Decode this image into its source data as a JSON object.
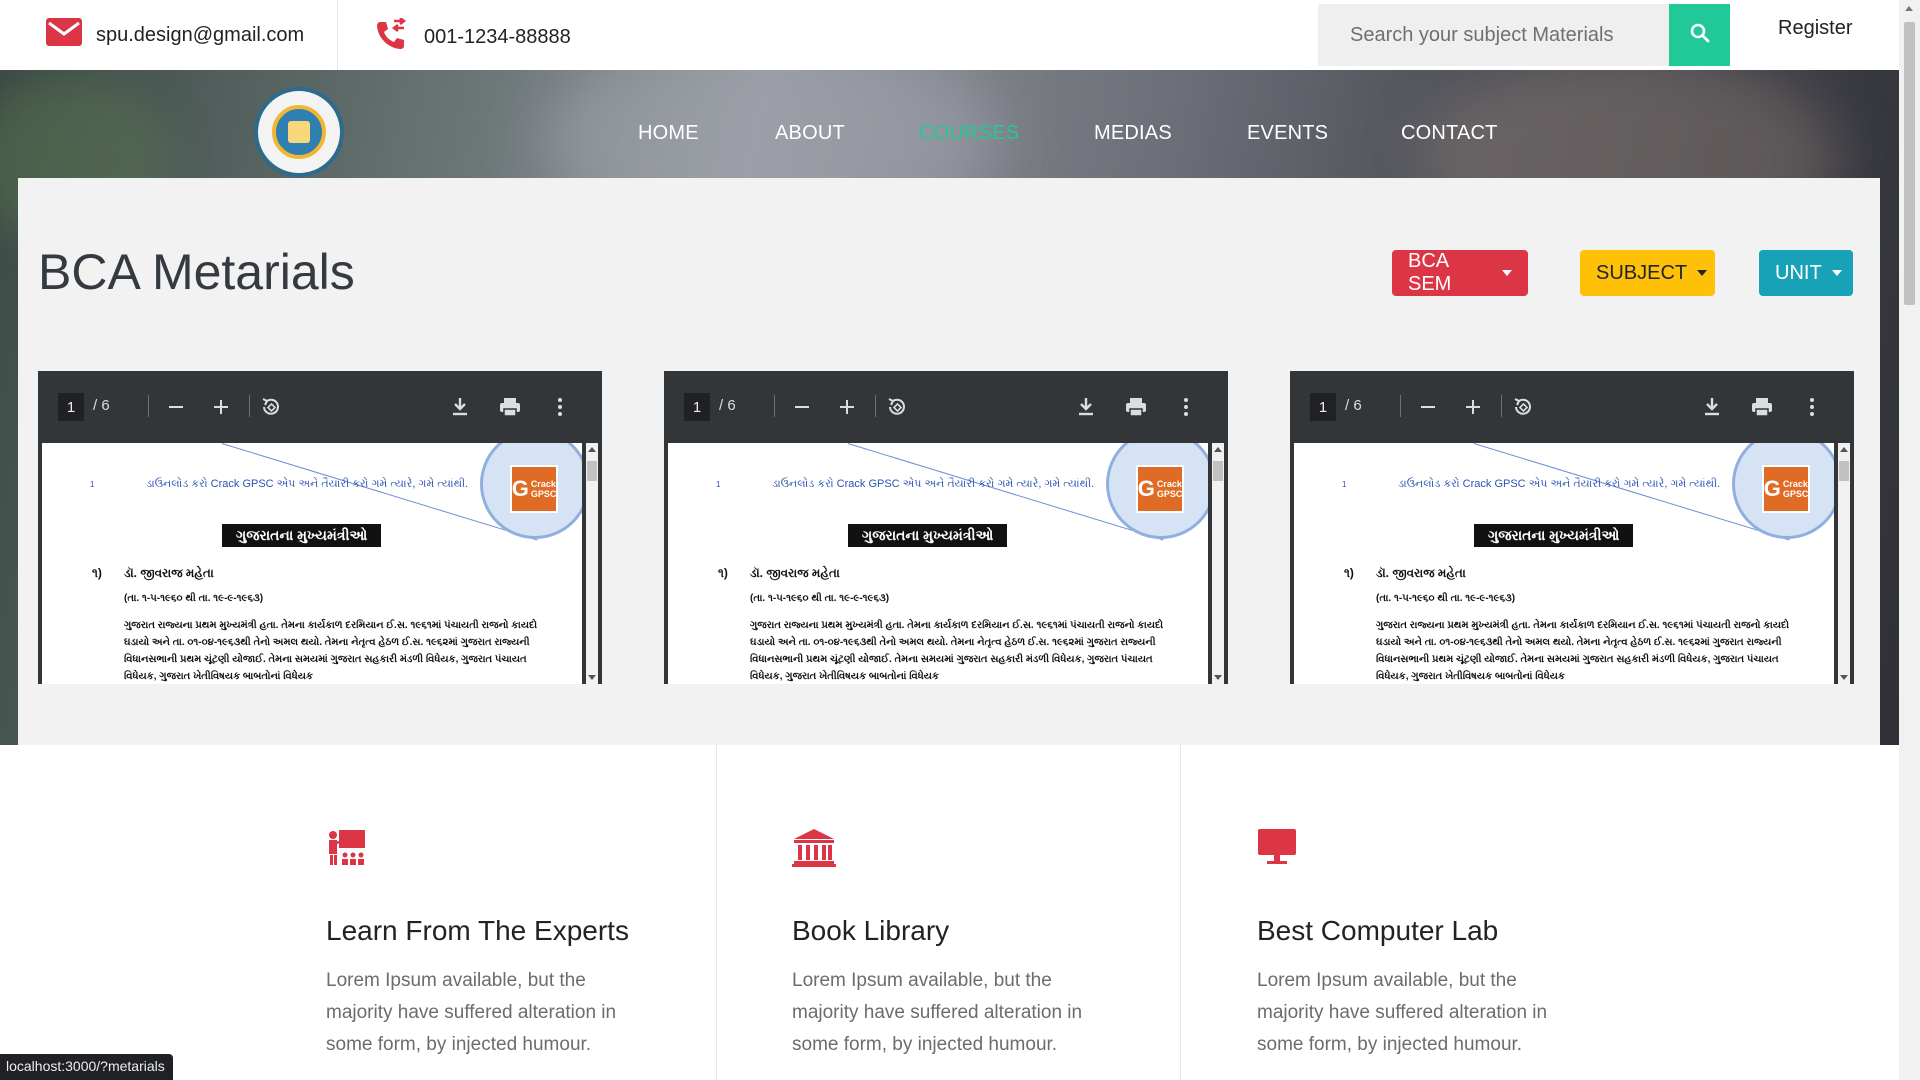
{
  "topbar": {
    "email": "spu.design@gmail.com",
    "phone": "001-1234-88888",
    "search_placeholder": "Search your subject Materials",
    "register": "Register"
  },
  "nav": {
    "items": [
      {
        "label": "HOME"
      },
      {
        "label": "ABOUT"
      },
      {
        "label": "COURSES",
        "active": true
      },
      {
        "label": "MEDIAS"
      },
      {
        "label": "EVENTS"
      },
      {
        "label": "CONTACT"
      }
    ]
  },
  "materials": {
    "title": "BCA Metarials",
    "buttons": {
      "sem": "BCA SEM",
      "subject": "SUBJECT",
      "unit": "UNIT"
    },
    "viewer": {
      "page": "1",
      "page_count": "/  6",
      "doc_number": "1",
      "banner": "ડાઉનલોડ કરો Crack GPSC એપ અને તૈયારી કરો ગમે ત્યારે, ગમે ત્યાંથી.",
      "logo_text": "Crack GPSC",
      "doc_title": "ગુજરાતના મુખ્યમંત્રીઓ",
      "item_no": "૧)",
      "item_name": "ડૉ. જીવરાજ મહેતા",
      "item_date": "(તા. ૧-૫-૧૯૬૦ થી તા. ૧૯-૯-૧૯૬૩)",
      "item_text": "ગુજરાત રાજ્યના પ્રથમ મુખ્યમંત્રી હતા. તેમના કાર્યકાળ દરમિયાન ઈ.સ. ૧૯૬૧માં પંચાયતી રાજનો કાયદો ઘડાયો અને તા. ૦૧-૦૪-૧૯૬૩થી તેનો અમલ થયો. તેમના નેતૃત્વ હેઠળ ઈ.સ. ૧૯૬૨માં ગુજરાત રાજ્યની વિધાનસભાની પ્રથમ ચૂંટણી યોજાઈ. તેમના સમયમાં ગુજરાત સહકારી મંડળી વિધેયક, ગુજરાત પંચાયત વિધેયક, ગુજરાત ખેતીવિષયક બાબતોનાં વિધેયક"
    }
  },
  "features": [
    {
      "icon": "teacher-icon",
      "title": "Learn From The Experts",
      "text": "Lorem Ipsum available, but the majority have suffered alteration in some form, by injected humour."
    },
    {
      "icon": "library-icon",
      "title": "Book Library",
      "text": "Lorem Ipsum available, but the majority have suffered alteration in some form, by injected humour."
    },
    {
      "icon": "monitor-icon",
      "title": "Best Computer Lab",
      "text": "Lorem Ipsum available, but the majority have suffered alteration in some form, by injected humour."
    }
  ],
  "status_url": "localhost:3000/?metarials",
  "colors": {
    "accent_green": "#20c997",
    "icon_red": "#dc3545",
    "sem_button": "#dc3545",
    "subject_button": "#ffc107",
    "unit_button": "#17a2b8",
    "pdf_toolbar": "#323639"
  }
}
